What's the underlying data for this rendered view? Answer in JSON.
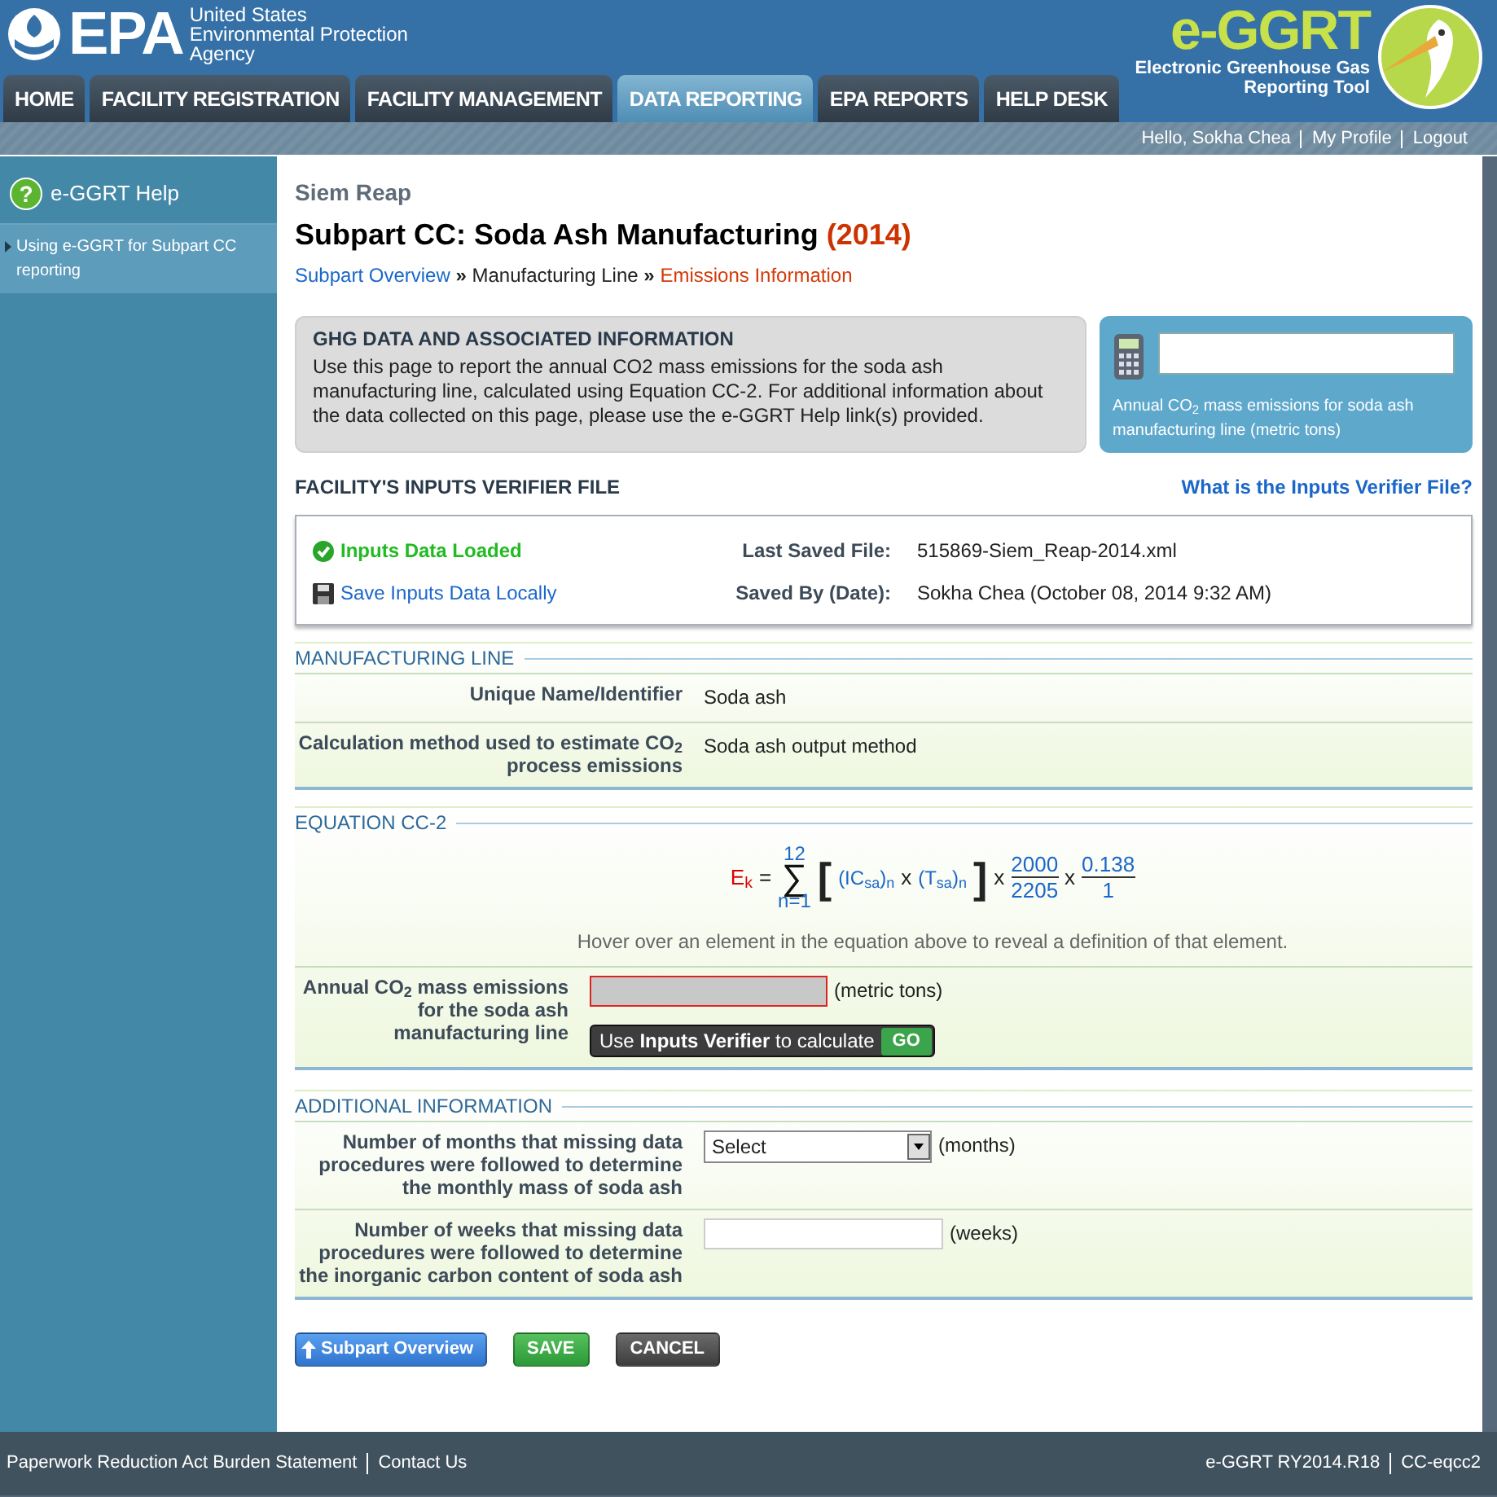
{
  "header": {
    "agency_mark": "EPA",
    "agency_lines": [
      "United States",
      "Environmental Protection",
      "Agency"
    ],
    "app_name": "e-GGRT",
    "app_subtitle": [
      "Electronic Greenhouse Gas",
      "Reporting Tool"
    ]
  },
  "tabs": [
    {
      "label": "HOME",
      "selected": false
    },
    {
      "label": "FACILITY REGISTRATION",
      "selected": false
    },
    {
      "label": "FACILITY MANAGEMENT",
      "selected": false
    },
    {
      "label": "DATA REPORTING",
      "selected": true
    },
    {
      "label": "EPA REPORTS",
      "selected": false
    },
    {
      "label": "HELP DESK",
      "selected": false
    }
  ],
  "greeting": "Hello, Sokha Chea",
  "user_links": [
    "My Profile",
    "Logout"
  ],
  "sidebar": {
    "help_glyph": "?",
    "title": "e-GGRT Help",
    "items": [
      {
        "label": "Using e-GGRT for Subpart CC reporting",
        "selected": true
      }
    ]
  },
  "facility": "Siem Reap",
  "title": "Subpart CC: Soda Ash Manufacturing",
  "year": "(2014)",
  "breadcrumb": [
    {
      "label": "Subpart Overview",
      "kind": "link"
    },
    {
      "label": "»",
      "kind": "sep"
    },
    {
      "label": "Manufacturing Line",
      "kind": "plain"
    },
    {
      "label": "»",
      "kind": "sep"
    },
    {
      "label": "Emissions Information",
      "kind": "current"
    }
  ],
  "info_box": {
    "heading": "GHG DATA AND ASSOCIATED INFORMATION",
    "text": "Use this page to report the annual CO2 mass emissions for the soda ash manufacturing line, calculated using Equation CC-2. For additional information about the data collected on this page, please use the e-GGRT Help link(s) provided."
  },
  "calc_box": {
    "caption": "Annual CO$_{2}$ mass emissions for soda ash manufacturing line (metric tons)"
  },
  "verifier": {
    "heading": "FACILITY'S INPUTS VERIFIER FILE",
    "help_link": "What is the Inputs Verifier File?",
    "status": "Inputs Data Loaded",
    "save_link": "Save Inputs Data Locally",
    "fields": [
      {
        "label": "Last Saved File:",
        "value": "515869-Siem_Reap-2014.xml"
      },
      {
        "label": "Saved By (Date):",
        "value": "Sokha Chea (October 08, 2014 9:32 AM)"
      }
    ]
  },
  "manufacturing_line": {
    "title": "MANUFACTURING LINE",
    "rows": [
      {
        "label": "Unique Name/Identifier",
        "value": "Soda ash"
      },
      {
        "label": "Calculation method used to estimate CO$_{2}$ process emissions",
        "value": "Soda ash output method"
      }
    ]
  },
  "equation": {
    "title": "EQUATION CC-2",
    "tokens": [
      {
        "kind": "lhs",
        "text": "E$_{k}$"
      },
      {
        "kind": "op",
        "text": "="
      },
      {
        "kind": "sum",
        "sign": "∑",
        "upper": "12",
        "lower": "n=1"
      },
      {
        "kind": "bracket",
        "text": "["
      },
      {
        "kind": "term",
        "text": "(IC$_{sa}$)$_{n}$"
      },
      {
        "kind": "op",
        "text": "x"
      },
      {
        "kind": "term",
        "text": "(T$_{sa}$)$_{n}$"
      },
      {
        "kind": "bracket",
        "text": "]"
      },
      {
        "kind": "op",
        "text": "x"
      },
      {
        "kind": "fraction",
        "num": "2000",
        "den": "2205"
      },
      {
        "kind": "op",
        "text": "x"
      },
      {
        "kind": "fraction",
        "num": "0.138",
        "den": "1"
      }
    ],
    "hint": "Hover over an element in the equation above to reveal a definition of that element.",
    "field": {
      "label": "Annual CO$_{2}$ mass emissions for the soda ash manufacturing line",
      "unit": "(metric tons)",
      "disabled": true,
      "invalid": true,
      "tip": "Use **Inputs Verifier** to calculate",
      "go": "GO"
    }
  },
  "additional": {
    "title": "ADDITIONAL INFORMATION",
    "rows": [
      {
        "label": "Number of months that missing data procedures were followed to determine the monthly mass of soda ash",
        "kind": "select",
        "value": "Select",
        "unit": "(months)"
      },
      {
        "label": "Number of weeks that missing data procedures were followed to determine the inorganic carbon content of soda ash",
        "kind": "text",
        "unit": "(weeks)"
      }
    ]
  },
  "buttons": [
    {
      "label": "Subpart Overview",
      "kind": "back"
    },
    {
      "label": "SAVE",
      "kind": "save"
    },
    {
      "label": "CANCEL",
      "kind": "cancel"
    }
  ],
  "footer": {
    "left": [
      "Paperwork Reduction Act Burden Statement",
      "Contact Us"
    ],
    "right": [
      "e-GGRT RY2014.R18",
      "CC-eqcc2"
    ]
  }
}
